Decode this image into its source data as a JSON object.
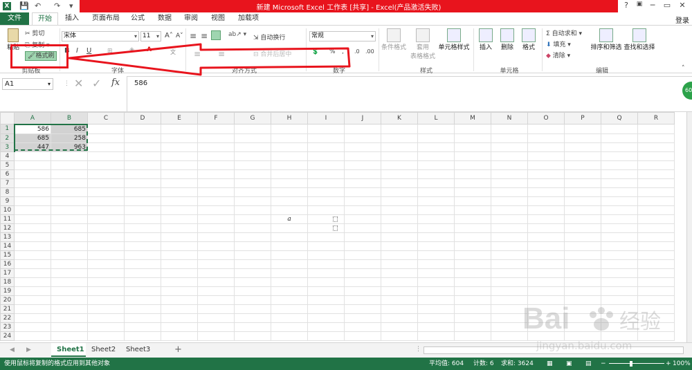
{
  "window": {
    "title": "新建 Microsoft Excel 工作表 [共享] - Excel(产品激活失败)",
    "help": "?",
    "minimize": "─",
    "restore": "▭",
    "close": "✕"
  },
  "quick_access": {
    "excel_logo": "X",
    "save": "💾",
    "undo": "↶",
    "redo": "↷",
    "customize": "▾"
  },
  "tabs": {
    "file": "文件",
    "items": [
      "开始",
      "插入",
      "页面布局",
      "公式",
      "数据",
      "审阅",
      "视图",
      "加载项"
    ],
    "login": "登录"
  },
  "ribbon": {
    "clipboard": {
      "paste": "粘贴",
      "cut": "剪切",
      "copy": "复制",
      "format_painter": "格式刷",
      "group": "剪贴板"
    },
    "font": {
      "name": "宋体",
      "size": "11",
      "grow": "A",
      "shrink": "A",
      "bold": "B",
      "italic": "I",
      "underline": "U",
      "group": "字体",
      "wen": "文"
    },
    "alignment": {
      "wrap": "自动换行",
      "merge": "合并后居中",
      "group": "对齐方式"
    },
    "number": {
      "format": "常规",
      "percent": "%",
      "comma": ",",
      "inc": ".0",
      "dec": ".00",
      "group": "数字"
    },
    "styles": {
      "conditional": "条件格式",
      "table_line1": "套用",
      "table_line2": "表格格式",
      "cell_styles": "单元格样式",
      "group": "样式"
    },
    "cells": {
      "insert": "插入",
      "delete": "删除",
      "format": "格式",
      "group": "单元格"
    },
    "editing": {
      "autosum": "自动求和",
      "fill": "填充",
      "clear": "清除",
      "sort": "排序和筛选",
      "find": "查找和选择",
      "group": "编辑"
    }
  },
  "formula_bar": {
    "name_box": "A1",
    "cancel": "✕",
    "enter": "✓",
    "fx": "fx",
    "content": "586"
  },
  "badge": "60",
  "sheet": {
    "columns": [
      "A",
      "B",
      "C",
      "D",
      "E",
      "F",
      "G",
      "H",
      "I",
      "J",
      "K",
      "L",
      "M",
      "N",
      "O",
      "P",
      "Q",
      "R"
    ],
    "rows": [
      "1",
      "2",
      "3",
      "4",
      "5",
      "6",
      "7",
      "8",
      "9",
      "10",
      "11",
      "12",
      "13",
      "14",
      "15",
      "16",
      "17",
      "18",
      "19",
      "20",
      "21",
      "22",
      "23",
      "24"
    ],
    "cells": {
      "A1": "586",
      "B1": "685",
      "A2": "685",
      "B2": "258",
      "A3": "447",
      "B3": "963",
      "H11": "a"
    }
  },
  "sheet_tabs": {
    "items": [
      "Sheet1",
      "Sheet2",
      "Sheet3"
    ],
    "active": "Sheet1",
    "add": "+"
  },
  "status": {
    "message": "使用鼠标将复制的格式应用到其他对象",
    "average": "平均值: 604",
    "count": "计数: 6",
    "sum": "求和: 3624",
    "zoom": "100%"
  },
  "watermark": {
    "brand": "Bai",
    "brand_cn": "经验",
    "url": "jingyan.baidu.com"
  }
}
